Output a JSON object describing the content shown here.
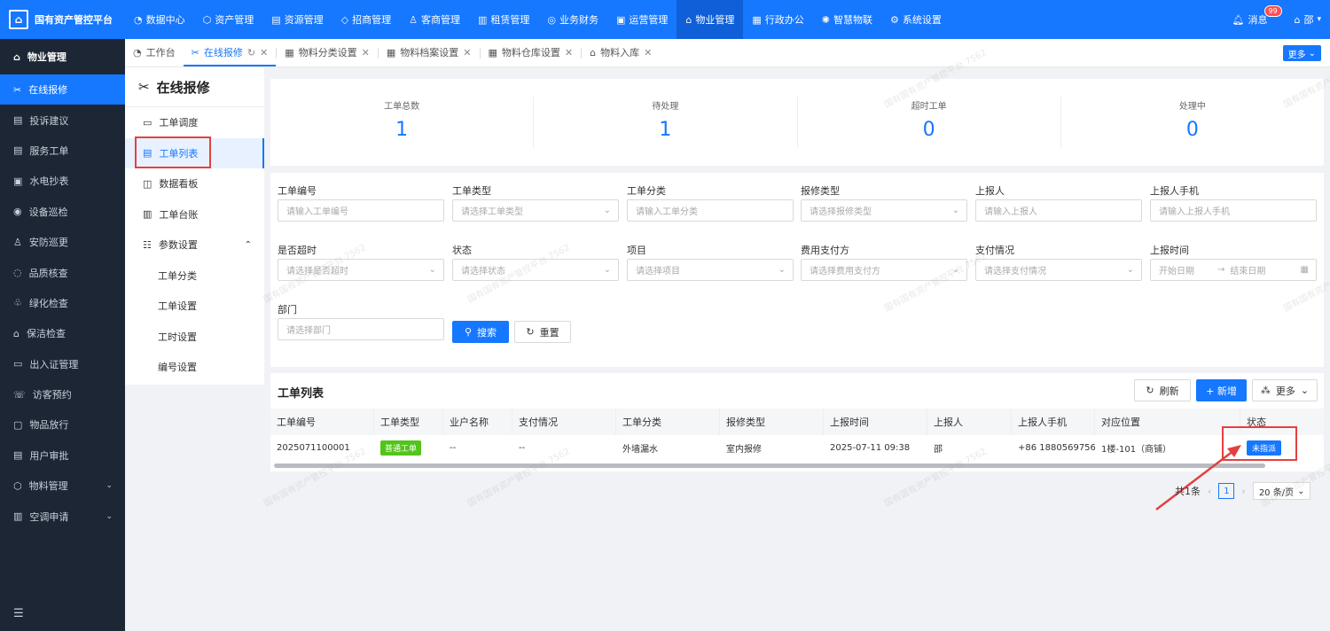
{
  "app": {
    "title": "国有资产管控平台",
    "user": "邵",
    "message_label": "消息",
    "message_count": "99"
  },
  "topnav": [
    "数据中心",
    "资产管理",
    "资源管理",
    "招商管理",
    "客商管理",
    "租赁管理",
    "业务财务",
    "运营管理",
    "物业管理",
    "行政办公",
    "智慧物联",
    "系统设置"
  ],
  "sidebar": {
    "header": "物业管理",
    "items": [
      "在线报修",
      "投诉建议",
      "服务工单",
      "水电抄表",
      "设备巡检",
      "安防巡更",
      "品质核查",
      "绿化检查",
      "保洁检查",
      "出入证管理",
      "访客预约",
      "物品放行",
      "用户审批",
      "物料管理",
      "空调申请"
    ]
  },
  "tabs": [
    "工作台",
    "在线报修",
    "物料分类设置",
    "物料档案设置",
    "物料仓库设置",
    "物料入库"
  ],
  "more_tabs": "更多",
  "subside": {
    "title": "在线报修",
    "items": [
      "工单调度",
      "工单列表",
      "数据看板",
      "工单台账",
      "参数设置"
    ],
    "children": [
      "工单分类",
      "工单设置",
      "工时设置",
      "编号设置"
    ]
  },
  "stats": [
    {
      "label": "工单总数",
      "value": "1"
    },
    {
      "label": "待处理",
      "value": "1"
    },
    {
      "label": "超时工单",
      "value": "0"
    },
    {
      "label": "处理中",
      "value": "0"
    }
  ],
  "filters": [
    {
      "label": "工单编号",
      "placeholder": "请输入工单编号"
    },
    {
      "label": "工单类型",
      "placeholder": "请选择工单类型"
    },
    {
      "label": "工单分类",
      "placeholder": "请输入工单分类"
    },
    {
      "label": "报修类型",
      "placeholder": "请选择报修类型"
    },
    {
      "label": "上报人",
      "placeholder": "请输入上报人"
    },
    {
      "label": "上报人手机",
      "placeholder": "请输入上报人手机"
    },
    {
      "label": "是否超时",
      "placeholder": "请选择是否超时"
    },
    {
      "label": "状态",
      "placeholder": "请选择状态"
    },
    {
      "label": "项目",
      "placeholder": "请选择项目"
    },
    {
      "label": "费用支付方",
      "placeholder": "请选择费用支付方"
    },
    {
      "label": "支付情况",
      "placeholder": "请选择支付情况"
    },
    {
      "label": "上报时间",
      "placeholder": "开始日期"
    },
    {
      "label": "部门",
      "placeholder": "请选择部门"
    }
  ],
  "date_end_placeholder": "结束日期",
  "buttons": {
    "search": "搜索",
    "reset": "重置",
    "refresh": "刷新",
    "add": "+ 新增",
    "more": "更多"
  },
  "list": {
    "title": "工单列表",
    "columns": [
      "工单编号",
      "工单类型",
      "业户名称",
      "支付情况",
      "工单分类",
      "报修类型",
      "上报时间",
      "上报人",
      "上报人手机",
      "对应位置",
      "状态"
    ],
    "rows": [
      [
        "2025071100001",
        "普通工单",
        "--",
        "--",
        "外墙漏水",
        "室内报修",
        "2025-07-11 09:38",
        "邵",
        "+86 18805697562",
        "1楼-101（商铺）",
        "未指派"
      ]
    ]
  },
  "pager": {
    "total": "共1条",
    "current": "1",
    "size": "20 条/页"
  },
  "watermark": "国有国有资产管控平台 7562"
}
